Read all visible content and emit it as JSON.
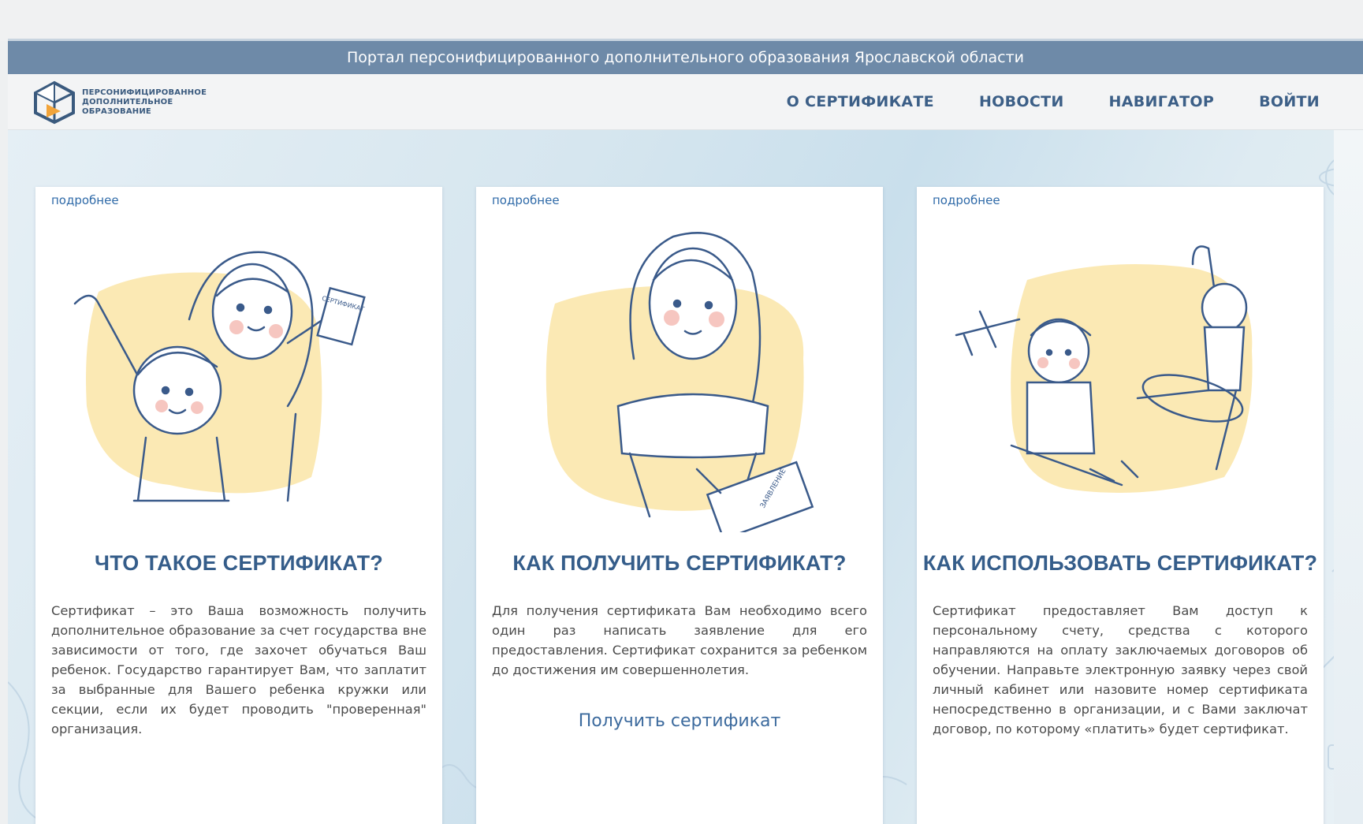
{
  "portal_title": "Портал персонифицированного дополнительного образования Ярославской области",
  "logo": {
    "lines": [
      "ПЕРСОНИФИЦИРОВАННОЕ",
      "ДОПОЛНИТЕЛЬНОЕ",
      "ОБРАЗОВАНИЕ"
    ]
  },
  "nav": {
    "about": "О СЕРТИФИКАТЕ",
    "news": "НОВОСТИ",
    "navigator": "НАВИГАТОР",
    "login": "ВОЙТИ"
  },
  "cards": [
    {
      "more": "подробнее",
      "title": "ЧТО ТАКОЕ СЕРТИФИКАТ?",
      "text": "Сертификат – это Ваша возможность получить дополнительное образование за счет государства вне зависимости от того, где захочет обучаться Ваш ребенок. Государство гарантирует Вам, что заплатит за выбранные для Вашего ребенка кружки или секции, если их будет проводить \"проверенная\" организация.",
      "sign_text": "СЕРТИФИКАТ"
    },
    {
      "more": "подробнее",
      "title": "КАК ПОЛУЧИТЬ СЕРТИФИКАТ?",
      "text": "Для получения сертификата Вам необходимо всего один раз написать заявление для его предоставления. Сертификат сохранится за ребенком до достижения им совершеннолетия.",
      "cta": "Получить сертификат",
      "sign_text": "ЗАЯВЛЕНИЕ"
    },
    {
      "more": "подробнее",
      "title": "КАК ИСПОЛЬЗОВАТЬ СЕРТИФИКАТ?",
      "text": "Сертификат предоставляет Вам доступ к персональному счету, средства с которого направляются на оплату заключаемых договоров об обучении. Направьте электронную заявку через свой личный кабинет или назовите номер сертификата непосредственно в организации, и с Вами заключат договор, по которому «платить» будет сертификат."
    }
  ],
  "colors": {
    "portal_bar": "#6e8aa8",
    "nav_text": "#3c5f87",
    "title_text": "#355d8a",
    "link": "#2f6aa8",
    "illustration_fill": "#fbe9b4",
    "illustration_line": "#3a5a8a"
  },
  "icons": [
    "logo-mark-icon"
  ]
}
